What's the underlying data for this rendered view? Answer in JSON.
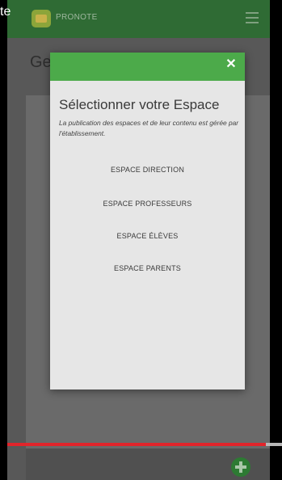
{
  "app": {
    "name": "PRONOTE",
    "page_heading_partial": "Ge"
  },
  "overlay": {
    "top_left_text": "te"
  },
  "modal": {
    "title": "Sélectionner votre Espace",
    "subtitle": "La publication des espaces et de leur contenu est gérée par l'établissement.",
    "close_symbol": "✕",
    "options": [
      {
        "label": "ESPACE DIRECTION"
      },
      {
        "label": "ESPACE PROFESSEURS"
      },
      {
        "label": "ESPACE ÉLÈVES"
      },
      {
        "label": "ESPACE PARENTS"
      }
    ]
  },
  "video": {
    "progress": 0.94
  },
  "colors": {
    "header_green": "#2f6b34",
    "modal_header_green": "#4caa4a",
    "progress_red": "#e1252b"
  },
  "icons": [
    "pronote-logo-icon",
    "hamburger-menu-icon",
    "close-icon",
    "add-icon"
  ]
}
